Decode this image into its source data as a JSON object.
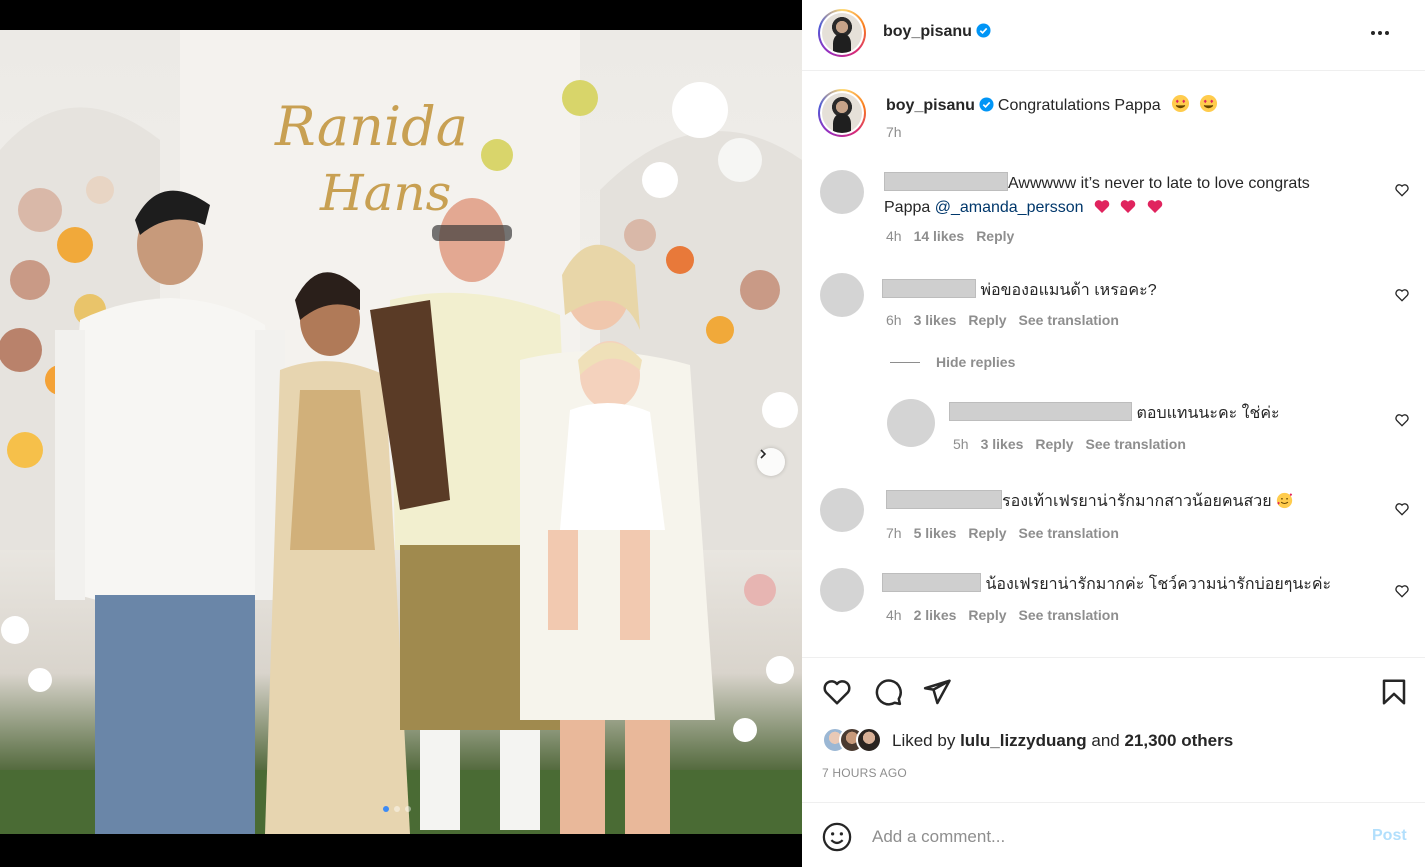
{
  "post": {
    "username": "boy_pisanu",
    "verified": true,
    "caption": "Congratulations Pappa",
    "caption_emojis": [
      "smiling-face-with-heart-eyes",
      "smiling-face-with-heart-eyes"
    ],
    "caption_time": "7h"
  },
  "media": {
    "backdrop_text": [
      "Ranida",
      "Hans"
    ],
    "carousel_dots": 3,
    "active_dot": 0
  },
  "comments": [
    {
      "text_pre": "Awwwww it’s never to late to love congrats",
      "text_line2": "Pappa",
      "mention": "@_amanda_persson",
      "time": "4h",
      "likes": "14 likes",
      "reply": "Reply"
    },
    {
      "text": "พ่อของอแมนด้า เหรอคะ?",
      "time": "6h",
      "likes": "3 likes",
      "reply": "Reply",
      "translate": "See translation"
    },
    {
      "text": "ตอบแทนนะคะ ใช่ค่ะ",
      "time": "5h",
      "likes": "3 likes",
      "reply": "Reply",
      "translate": "See translation"
    },
    {
      "text": "รองเท้าเฟรยาน่ารักมากสาวน้อยคนสวย",
      "time": "7h",
      "likes": "5 likes",
      "reply": "Reply",
      "translate": "See translation"
    },
    {
      "text": "น้องเฟรยาน่ารักมากค่ะ โชว์ความน่ารักบ่อยๆนะค่ะ",
      "time": "4h",
      "likes": "2 likes",
      "reply": "Reply",
      "translate": "See translation"
    }
  ],
  "hide_replies": "Hide replies",
  "likes": {
    "prefix": "Liked by",
    "user": "lulu_lizzyduang",
    "middle": "and",
    "others": "21,300 others"
  },
  "posted_time": "7 HOURS AGO",
  "comment_box": {
    "placeholder": "Add a comment...",
    "post_label": "Post"
  },
  "colors": {
    "accent": "#0095f6",
    "post_disabled": "#b2dffc",
    "heart_red": "#ed4956",
    "mention": "#00376b"
  }
}
